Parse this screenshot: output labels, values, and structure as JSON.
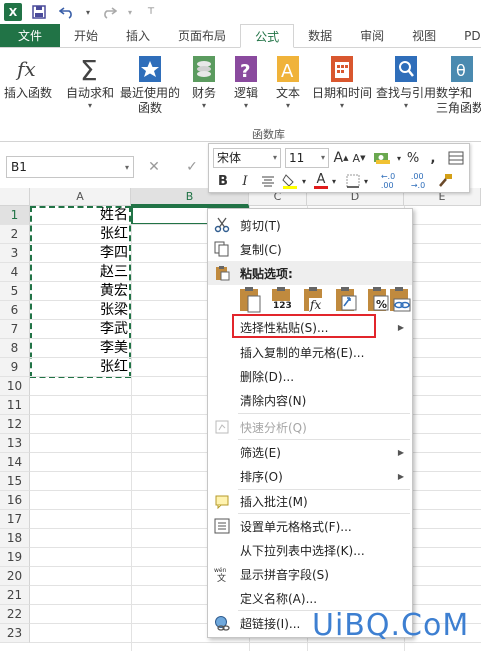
{
  "titlebar": {
    "logo": "X",
    "icons": [
      "excel-logo-icon",
      "save-icon",
      "undo-icon",
      "redo-icon"
    ]
  },
  "tabs": [
    {
      "label": "文件",
      "id": "file"
    },
    {
      "label": "开始",
      "id": "home"
    },
    {
      "label": "插入",
      "id": "insert"
    },
    {
      "label": "页面布局",
      "id": "page-layout"
    },
    {
      "label": "公式",
      "id": "formulas",
      "active": true
    },
    {
      "label": "数据",
      "id": "data"
    },
    {
      "label": "审阅",
      "id": "review"
    },
    {
      "label": "视图",
      "id": "view"
    },
    {
      "label": "PD",
      "id": "pdf"
    }
  ],
  "ribbon": {
    "buttons": [
      {
        "label": "插入函数",
        "icon": "fx-icon"
      },
      {
        "label": "自动求和",
        "icon": "sigma-icon"
      },
      {
        "label": "最近使用的",
        "label2": "函数",
        "icon": "star-icon"
      },
      {
        "label": "财务",
        "icon": "coins-icon"
      },
      {
        "label": "逻辑",
        "icon": "question-icon"
      },
      {
        "label": "文本",
        "icon": "text-a-icon"
      },
      {
        "label": "日期和时间",
        "icon": "calendar-icon"
      },
      {
        "label": "查找与引用",
        "icon": "lookup-icon"
      },
      {
        "label": "数学和",
        "label2": "三角函数",
        "icon": "theta-icon"
      }
    ],
    "group_label": "函数库"
  },
  "formula_bar": {
    "name_box": "B1",
    "cancel_glyph": "✕",
    "enter_glyph": "✓"
  },
  "grid": {
    "columns": [
      "A",
      "B",
      "C",
      "D",
      "E"
    ],
    "selected_column": "B",
    "rows": [
      "1",
      "2",
      "3",
      "4",
      "5",
      "6",
      "7",
      "8",
      "9",
      "10",
      "11",
      "12",
      "13",
      "14",
      "15",
      "16",
      "17",
      "18",
      "19",
      "20",
      "21",
      "22",
      "23"
    ],
    "column_a": [
      "姓名",
      "张红",
      "李四",
      "赵三",
      "黄宏",
      "张梁",
      "李武",
      "李美",
      "张红"
    ]
  },
  "mini_toolbar": {
    "font": "宋体",
    "size": "11",
    "grow": "A",
    "shrink": "A",
    "percent": "%",
    "comma": ",",
    "bold": "B",
    "italic": "I",
    "font_color_letter": "A",
    "inc_decimal": "←.0\n.00",
    "dec_decimal": ".00\n→.0"
  },
  "context_menu": {
    "cut": "剪切(T)",
    "copy": "复制(C)",
    "paste_options": "粘贴选项:",
    "paste_special": "选择性粘贴(S)...",
    "insert_copied": "插入复制的单元格(E)...",
    "delete": "删除(D)...",
    "clear": "清除内容(N)",
    "quick_analysis": "快速分析(Q)",
    "filter": "筛选(E)",
    "sort": "排序(O)",
    "insert_comment": "插入批注(M)",
    "format_cells": "设置单元格格式(F)...",
    "pick_from_list": "从下拉列表中选择(K)...",
    "phonetic": "显示拼音字段(S)",
    "define_name": "定义名称(A)...",
    "hyperlink": "超链接(I)...",
    "paste_icon_labels": [
      "123",
      "fx"
    ]
  },
  "watermark": "UiBQ.CoM",
  "colors": {
    "excel_green": "#217346",
    "highlight_red": "#e2252b",
    "watermark_blue": "#3d7fd1"
  }
}
